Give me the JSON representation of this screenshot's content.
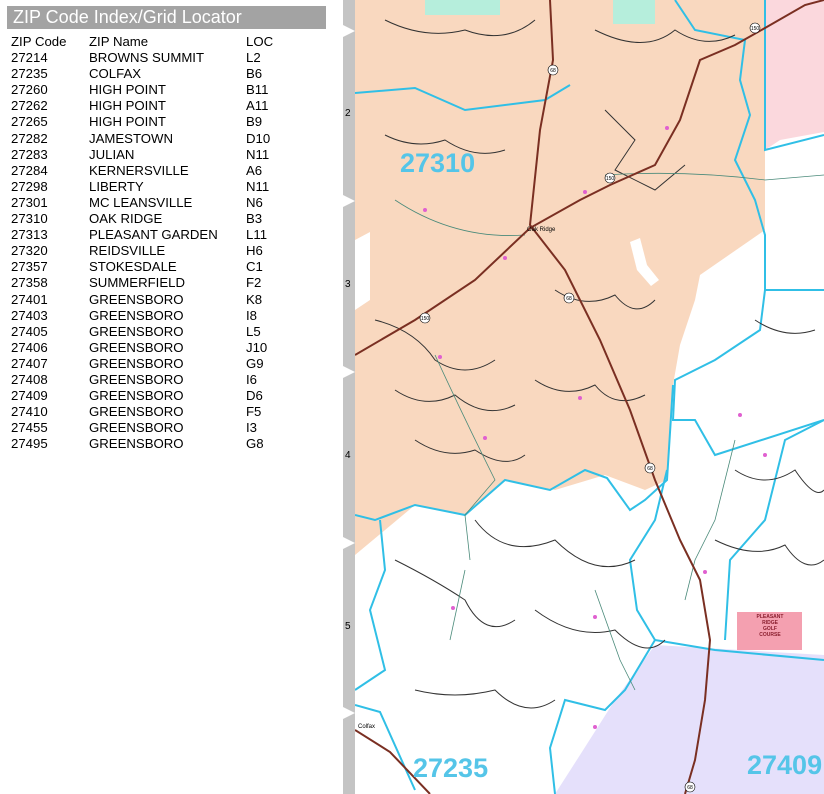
{
  "index": {
    "title": "ZIP Code Index/Grid Locator",
    "headers": {
      "code": "ZIP Code",
      "name": "ZIP Name",
      "loc": "LOC"
    },
    "rows": [
      {
        "code": "27214",
        "name": "BROWNS SUMMIT",
        "loc": "L2"
      },
      {
        "code": "27235",
        "name": "COLFAX",
        "loc": "B6"
      },
      {
        "code": "27260",
        "name": "HIGH POINT",
        "loc": "B11"
      },
      {
        "code": "27262",
        "name": "HIGH POINT",
        "loc": "A11"
      },
      {
        "code": "27265",
        "name": "HIGH POINT",
        "loc": "B9"
      },
      {
        "code": "27282",
        "name": "JAMESTOWN",
        "loc": "D10"
      },
      {
        "code": "27283",
        "name": "JULIAN",
        "loc": "N11"
      },
      {
        "code": "27284",
        "name": "KERNERSVILLE",
        "loc": "A6"
      },
      {
        "code": "27298",
        "name": "LIBERTY",
        "loc": "N11"
      },
      {
        "code": "27301",
        "name": "MC LEANSVILLE",
        "loc": "N6"
      },
      {
        "code": "27310",
        "name": "OAK RIDGE",
        "loc": "B3"
      },
      {
        "code": "27313",
        "name": "PLEASANT GARDEN",
        "loc": "L11"
      },
      {
        "code": "27320",
        "name": "REIDSVILLE",
        "loc": "H6"
      },
      {
        "code": "27357",
        "name": "STOKESDALE",
        "loc": "C1"
      },
      {
        "code": "27358",
        "name": "SUMMERFIELD",
        "loc": "F2"
      },
      {
        "code": "27401",
        "name": "GREENSBORO",
        "loc": "K8"
      },
      {
        "code": "27403",
        "name": "GREENSBORO",
        "loc": "I8"
      },
      {
        "code": "27405",
        "name": "GREENSBORO",
        "loc": "L5"
      },
      {
        "code": "27406",
        "name": "GREENSBORO",
        "loc": "J10"
      },
      {
        "code": "27407",
        "name": "GREENSBORO",
        "loc": "G9"
      },
      {
        "code": "27408",
        "name": "GREENSBORO",
        "loc": "I6"
      },
      {
        "code": "27409",
        "name": "GREENSBORO",
        "loc": "D6"
      },
      {
        "code": "27410",
        "name": "GREENSBORO",
        "loc": "F5"
      },
      {
        "code": "27455",
        "name": "GREENSBORO",
        "loc": "I3"
      },
      {
        "code": "27495",
        "name": "GREENSBORO",
        "loc": "G8"
      }
    ]
  },
  "grid_rows": [
    "2",
    "3",
    "4",
    "5"
  ],
  "map": {
    "zip_labels": [
      "27310",
      "27235",
      "27409"
    ],
    "places": {
      "oak_ridge": "Oak Ridge",
      "colfax": "Colfax"
    },
    "golf": [
      "PLEASANT",
      "RIDGE",
      "GOLF",
      "COURSE"
    ],
    "shields": [
      "150",
      "68",
      "150",
      "68",
      "150",
      "68",
      "68"
    ]
  },
  "colors": {
    "zip_27310_fill": "#f9d8bf",
    "zip_27409_fill": "#e5e0fb",
    "pink_zone": "#fbd8dd",
    "green_zone": "#b6eedc",
    "zip_boundary": "#30bfe6",
    "highway": "#7a2f22",
    "local_road": "#333333",
    "zip_label": "#55c5e8"
  }
}
